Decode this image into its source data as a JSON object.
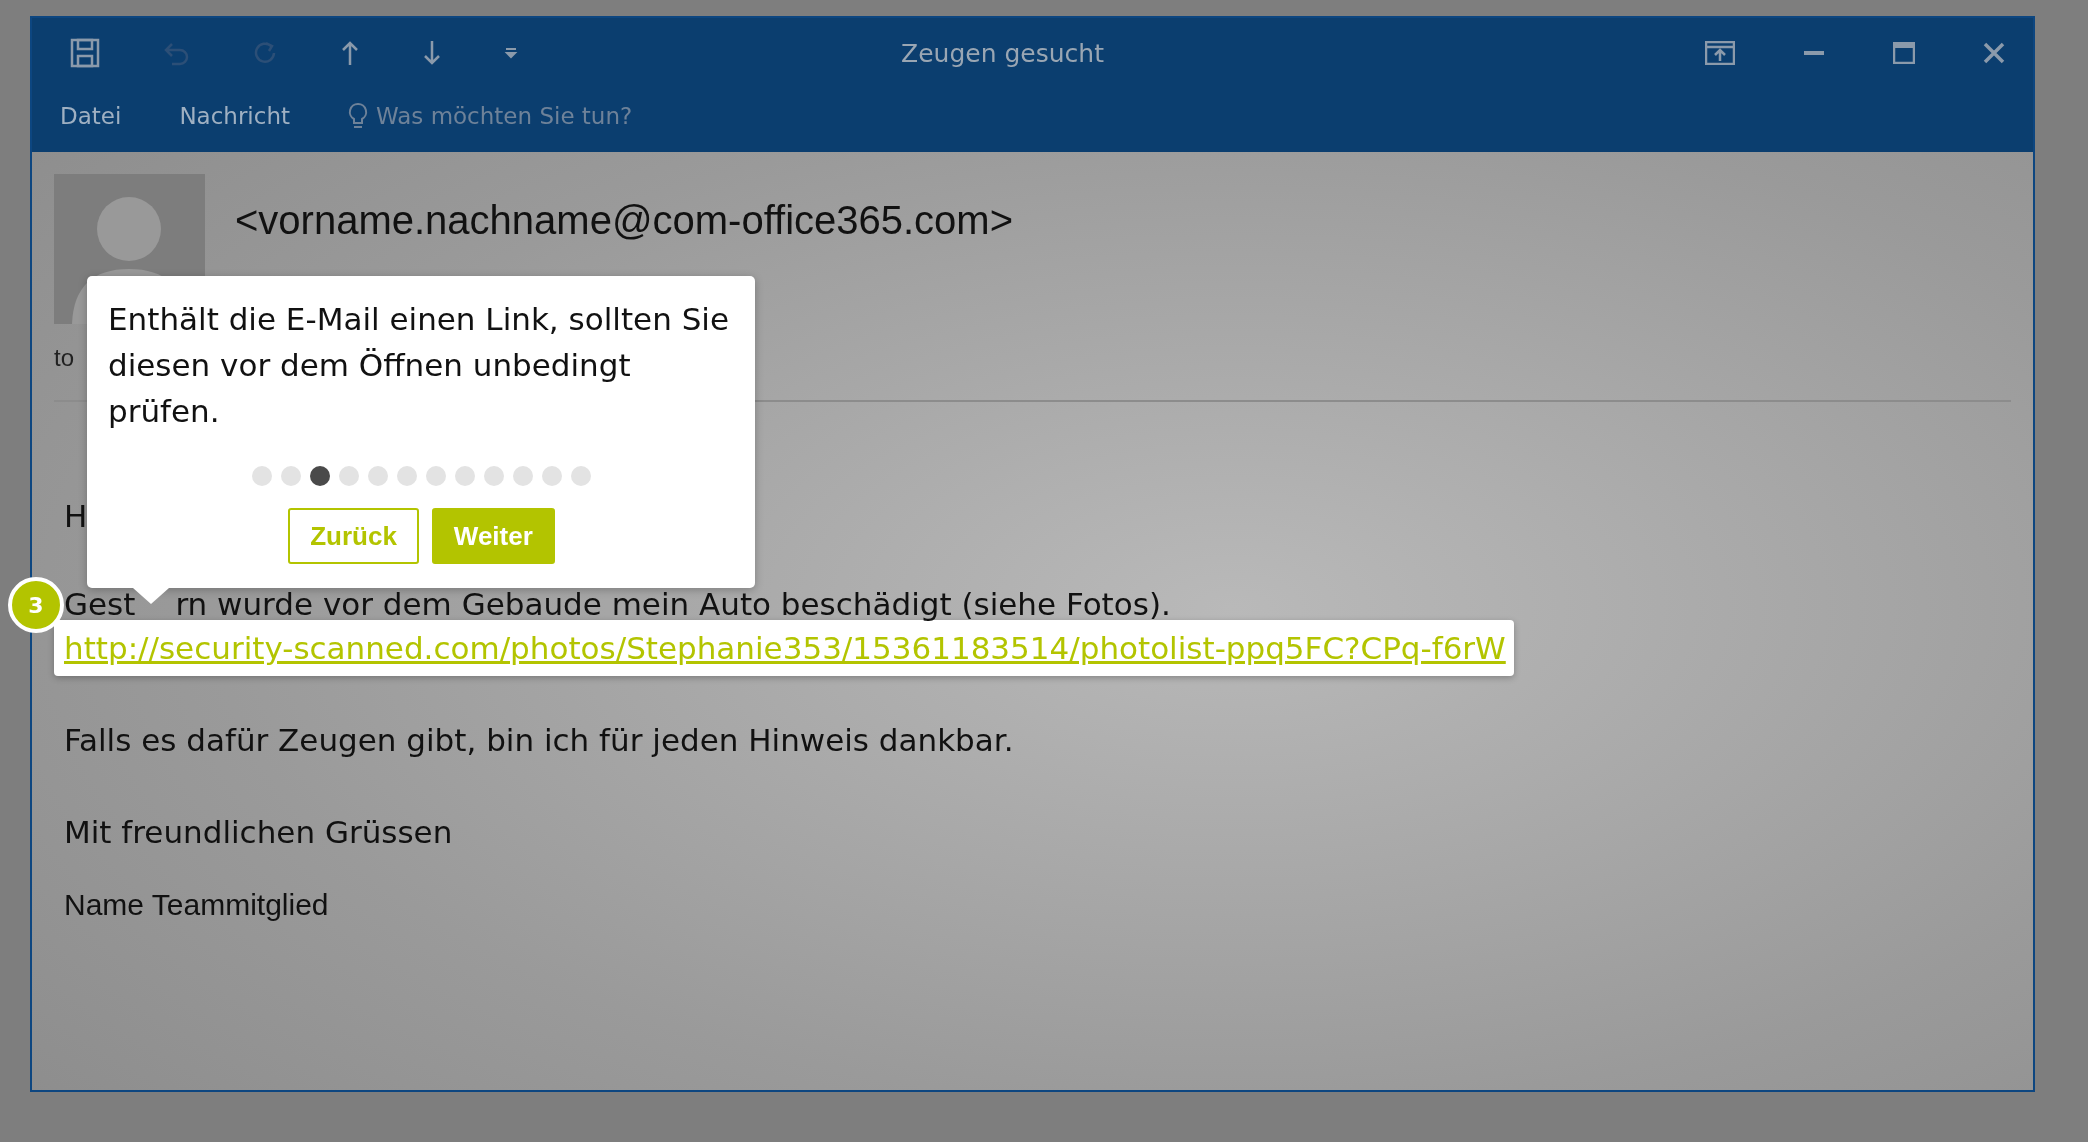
{
  "window": {
    "title": "Zeugen gesucht"
  },
  "ribbon_tabs": [
    {
      "label": "Datei"
    },
    {
      "label": "Nachricht"
    }
  ],
  "tell_me": {
    "placeholder": "Was möchten Sie tun?"
  },
  "email": {
    "from": "<vorname.nachname@com-office365.com>",
    "to_label": "to",
    "greeting": "H",
    "paragraph_parts": [
      "Gest",
      "rn wurde vor dem Gebaude mein Auto beschädigt (siehe Fotos)."
    ],
    "link": "http://security-scanned.com/photos/Stephanie353/15361183514/photolist-ppq5FC?CPq-f6rW",
    "after": [
      "Falls es dafür Zeugen gibt, bin ich für jeden Hinweis dankbar.",
      "Mit freundlichen Grüssen"
    ],
    "signature": "Name Teammitglied"
  },
  "tour": {
    "text": "Enthält die E-Mail einen Link, sollten Sie diesen vor dem Öffnen unbedingt prüfen.",
    "steps": [
      {
        "selected": false
      },
      {
        "selected": false
      },
      {
        "selected": true
      },
      {
        "selected": false
      },
      {
        "selected": false
      },
      {
        "selected": false
      },
      {
        "selected": false
      },
      {
        "selected": false
      },
      {
        "selected": false
      },
      {
        "selected": false
      },
      {
        "selected": false
      },
      {
        "selected": false
      }
    ],
    "buttons": [
      {
        "label": "Zurück",
        "kind": "outline"
      },
      {
        "label": "Weiter",
        "kind": "primary"
      }
    ],
    "badge": "3"
  }
}
